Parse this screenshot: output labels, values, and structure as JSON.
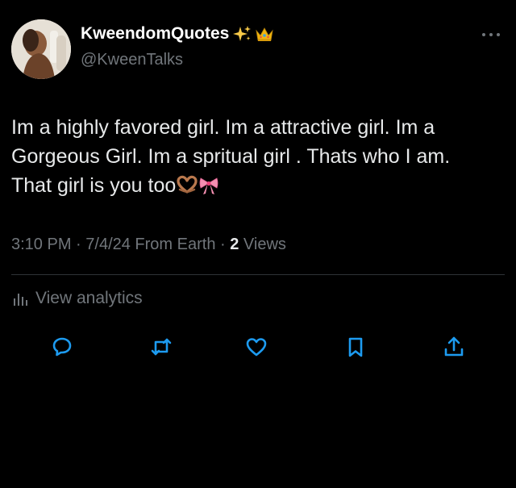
{
  "author": {
    "display_name": "KweendomQuotes",
    "display_name_emojis": [
      "sparkles-icon",
      "crown-icon"
    ],
    "handle": "@KweenTalks"
  },
  "tweet": {
    "lines": [
      "Im a highly favored girl. Im a attractive girl. Im a",
      "Gorgeous Girl. Im a spritual girl . Thats who I am.",
      "That girl is you too"
    ],
    "trailing_emojis": [
      "heart-hands-icon",
      "ribbon-icon"
    ]
  },
  "meta": {
    "time": "3:10 PM",
    "sep1": " · ",
    "date": "7/4/24",
    "source": " From Earth",
    "sep2": " · ",
    "views_count": "2",
    "views_label": " Views"
  },
  "analytics": {
    "label": "View analytics"
  },
  "actions": [
    "reply-icon",
    "retweet-icon",
    "like-icon",
    "bookmark-icon",
    "share-icon"
  ],
  "colors": {
    "background": "#000000",
    "primary_text": "#e7e9ea",
    "secondary_text": "#71767b",
    "divider": "#2f3336"
  }
}
